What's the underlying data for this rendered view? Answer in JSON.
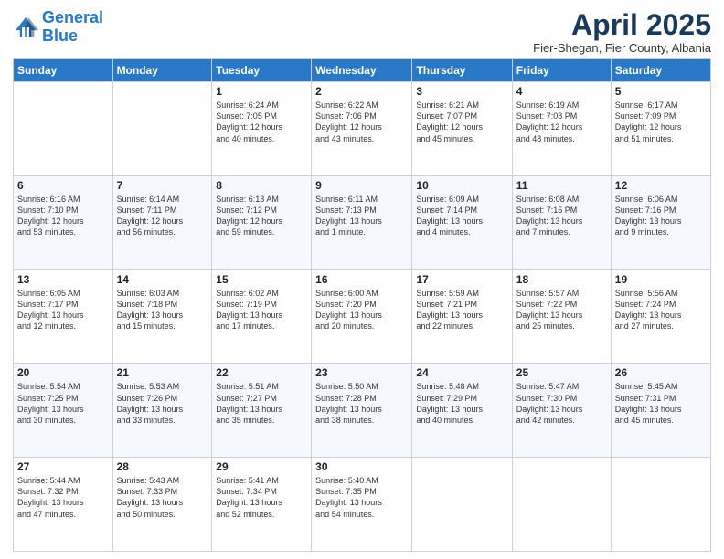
{
  "logo": {
    "line1": "General",
    "line2": "Blue"
  },
  "title": "April 2025",
  "location": "Fier-Shegan, Fier County, Albania",
  "days_of_week": [
    "Sunday",
    "Monday",
    "Tuesday",
    "Wednesday",
    "Thursday",
    "Friday",
    "Saturday"
  ],
  "weeks": [
    [
      {
        "day": "",
        "info": ""
      },
      {
        "day": "",
        "info": ""
      },
      {
        "day": "1",
        "info": "Sunrise: 6:24 AM\nSunset: 7:05 PM\nDaylight: 12 hours\nand 40 minutes."
      },
      {
        "day": "2",
        "info": "Sunrise: 6:22 AM\nSunset: 7:06 PM\nDaylight: 12 hours\nand 43 minutes."
      },
      {
        "day": "3",
        "info": "Sunrise: 6:21 AM\nSunset: 7:07 PM\nDaylight: 12 hours\nand 45 minutes."
      },
      {
        "day": "4",
        "info": "Sunrise: 6:19 AM\nSunset: 7:08 PM\nDaylight: 12 hours\nand 48 minutes."
      },
      {
        "day": "5",
        "info": "Sunrise: 6:17 AM\nSunset: 7:09 PM\nDaylight: 12 hours\nand 51 minutes."
      }
    ],
    [
      {
        "day": "6",
        "info": "Sunrise: 6:16 AM\nSunset: 7:10 PM\nDaylight: 12 hours\nand 53 minutes."
      },
      {
        "day": "7",
        "info": "Sunrise: 6:14 AM\nSunset: 7:11 PM\nDaylight: 12 hours\nand 56 minutes."
      },
      {
        "day": "8",
        "info": "Sunrise: 6:13 AM\nSunset: 7:12 PM\nDaylight: 12 hours\nand 59 minutes."
      },
      {
        "day": "9",
        "info": "Sunrise: 6:11 AM\nSunset: 7:13 PM\nDaylight: 13 hours\nand 1 minute."
      },
      {
        "day": "10",
        "info": "Sunrise: 6:09 AM\nSunset: 7:14 PM\nDaylight: 13 hours\nand 4 minutes."
      },
      {
        "day": "11",
        "info": "Sunrise: 6:08 AM\nSunset: 7:15 PM\nDaylight: 13 hours\nand 7 minutes."
      },
      {
        "day": "12",
        "info": "Sunrise: 6:06 AM\nSunset: 7:16 PM\nDaylight: 13 hours\nand 9 minutes."
      }
    ],
    [
      {
        "day": "13",
        "info": "Sunrise: 6:05 AM\nSunset: 7:17 PM\nDaylight: 13 hours\nand 12 minutes."
      },
      {
        "day": "14",
        "info": "Sunrise: 6:03 AM\nSunset: 7:18 PM\nDaylight: 13 hours\nand 15 minutes."
      },
      {
        "day": "15",
        "info": "Sunrise: 6:02 AM\nSunset: 7:19 PM\nDaylight: 13 hours\nand 17 minutes."
      },
      {
        "day": "16",
        "info": "Sunrise: 6:00 AM\nSunset: 7:20 PM\nDaylight: 13 hours\nand 20 minutes."
      },
      {
        "day": "17",
        "info": "Sunrise: 5:59 AM\nSunset: 7:21 PM\nDaylight: 13 hours\nand 22 minutes."
      },
      {
        "day": "18",
        "info": "Sunrise: 5:57 AM\nSunset: 7:22 PM\nDaylight: 13 hours\nand 25 minutes."
      },
      {
        "day": "19",
        "info": "Sunrise: 5:56 AM\nSunset: 7:24 PM\nDaylight: 13 hours\nand 27 minutes."
      }
    ],
    [
      {
        "day": "20",
        "info": "Sunrise: 5:54 AM\nSunset: 7:25 PM\nDaylight: 13 hours\nand 30 minutes."
      },
      {
        "day": "21",
        "info": "Sunrise: 5:53 AM\nSunset: 7:26 PM\nDaylight: 13 hours\nand 33 minutes."
      },
      {
        "day": "22",
        "info": "Sunrise: 5:51 AM\nSunset: 7:27 PM\nDaylight: 13 hours\nand 35 minutes."
      },
      {
        "day": "23",
        "info": "Sunrise: 5:50 AM\nSunset: 7:28 PM\nDaylight: 13 hours\nand 38 minutes."
      },
      {
        "day": "24",
        "info": "Sunrise: 5:48 AM\nSunset: 7:29 PM\nDaylight: 13 hours\nand 40 minutes."
      },
      {
        "day": "25",
        "info": "Sunrise: 5:47 AM\nSunset: 7:30 PM\nDaylight: 13 hours\nand 42 minutes."
      },
      {
        "day": "26",
        "info": "Sunrise: 5:45 AM\nSunset: 7:31 PM\nDaylight: 13 hours\nand 45 minutes."
      }
    ],
    [
      {
        "day": "27",
        "info": "Sunrise: 5:44 AM\nSunset: 7:32 PM\nDaylight: 13 hours\nand 47 minutes."
      },
      {
        "day": "28",
        "info": "Sunrise: 5:43 AM\nSunset: 7:33 PM\nDaylight: 13 hours\nand 50 minutes."
      },
      {
        "day": "29",
        "info": "Sunrise: 5:41 AM\nSunset: 7:34 PM\nDaylight: 13 hours\nand 52 minutes."
      },
      {
        "day": "30",
        "info": "Sunrise: 5:40 AM\nSunset: 7:35 PM\nDaylight: 13 hours\nand 54 minutes."
      },
      {
        "day": "",
        "info": ""
      },
      {
        "day": "",
        "info": ""
      },
      {
        "day": "",
        "info": ""
      }
    ]
  ]
}
